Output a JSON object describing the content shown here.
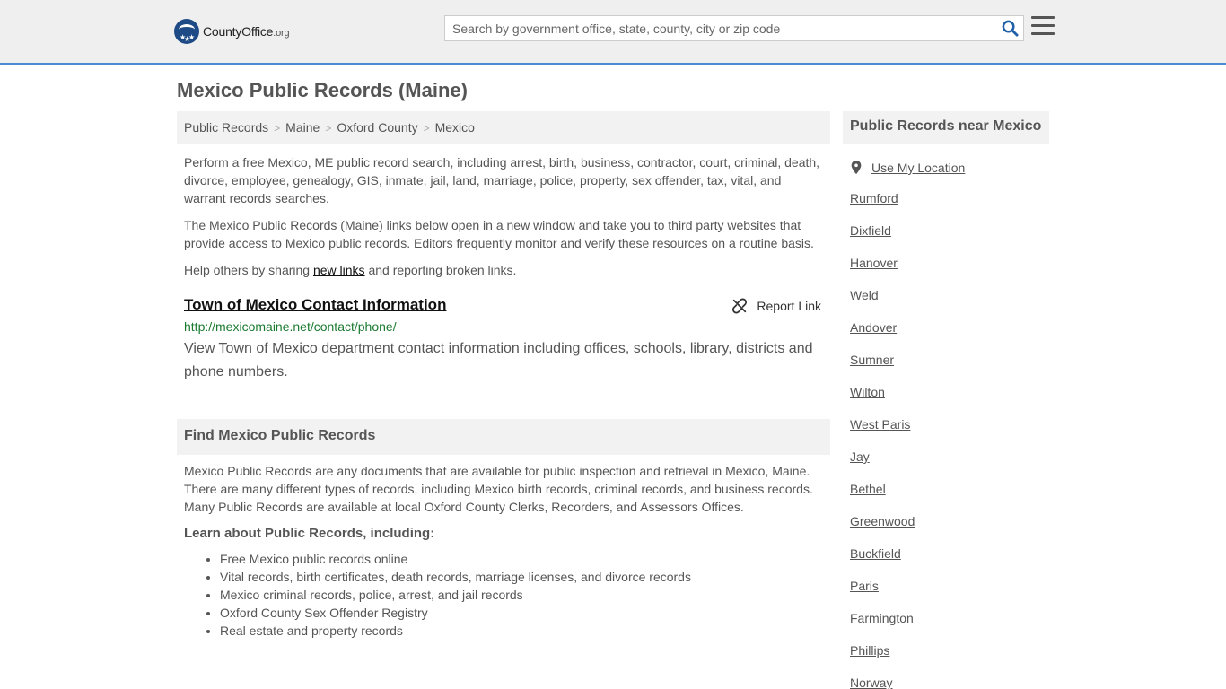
{
  "header": {
    "logo_main": "CountyOffice",
    "logo_tld": ".org",
    "search_placeholder": "Search by government office, state, county, city or zip code"
  },
  "page_title": "Mexico Public Records (Maine)",
  "breadcrumb": [
    "Public Records",
    "Maine",
    "Oxford County",
    "Mexico"
  ],
  "intro": {
    "p1": "Perform a free Mexico, ME public record search, including arrest, birth, business, contractor, court, criminal, death, divorce, employee, genealogy, GIS, inmate, jail, land, marriage, police, property, sex offender, tax, vital, and warrant records searches.",
    "p2": "The Mexico Public Records (Maine) links below open in a new window and take you to third party websites that provide access to Mexico public records. Editors frequently monitor and verify these resources on a routine basis.",
    "p3_before": "Help others by sharing ",
    "p3_link": "new links",
    "p3_after": " and reporting broken links."
  },
  "listing": {
    "title": "Town of Mexico Contact Information",
    "report_label": "Report Link",
    "url": "http://mexicomaine.net/contact/phone/",
    "description": "View Town of Mexico department contact information including offices, schools, library, districts and phone numbers."
  },
  "find": {
    "heading": "Find Mexico Public Records",
    "body": "Mexico Public Records are any documents that are available for public inspection and retrieval in Mexico, Maine. There are many different types of records, including Mexico birth records, criminal records, and business records. Many Public Records are available at local Oxford County Clerks, Recorders, and Assessors Offices.",
    "learn_heading": "Learn about Public Records, including:",
    "items": [
      "Free Mexico public records online",
      "Vital records, birth certificates, death records, marriage licenses, and divorce records",
      "Mexico criminal records, police, arrest, and jail records",
      "Oxford County Sex Offender Registry",
      "Real estate and property records"
    ]
  },
  "sidebar": {
    "heading": "Public Records near Mexico",
    "use_location": "Use My Location",
    "cities": [
      "Rumford",
      "Dixfield",
      "Hanover",
      "Weld",
      "Andover",
      "Sumner",
      "Wilton",
      "West Paris",
      "Jay",
      "Bethel",
      "Greenwood",
      "Buckfield",
      "Paris",
      "Farmington",
      "Phillips",
      "Norway"
    ]
  },
  "colors": {
    "header_bg": "#efefef",
    "header_border": "#4a8bd3",
    "logo_blue": "#1e4a86",
    "search_icon": "#1e5fa8",
    "url_green": "#1a7a30"
  }
}
